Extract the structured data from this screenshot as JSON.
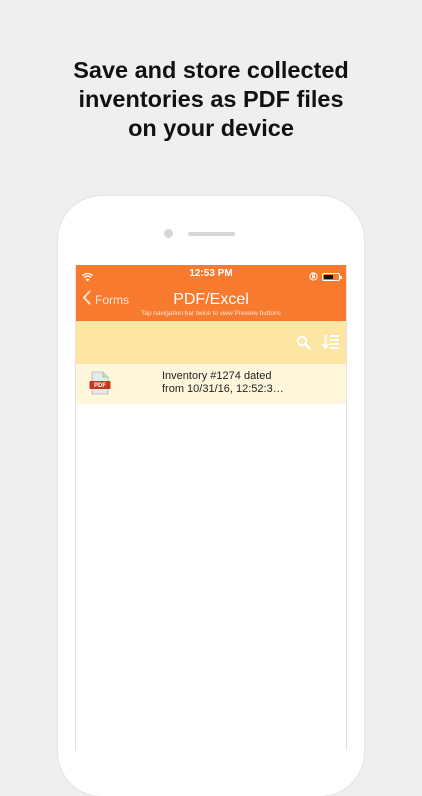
{
  "promo": {
    "line1": "Save and store collected",
    "line2": "inventories as PDF files",
    "line3": "on your device"
  },
  "status_bar": {
    "time": "12:53 PM",
    "battery_level": 0.65
  },
  "nav_bar": {
    "back_label": "Forms",
    "title": "PDF/Excel",
    "subtitle": "Tap navigation bar twice to view Preview buttons"
  },
  "file_list": [
    {
      "line1": "Inventory #1274 dated",
      "line2": "from 10/31/16, 12:52:3…",
      "badge": "PDF"
    }
  ],
  "colors": {
    "accent": "#f77a2f",
    "toolbar": "#fde6a4",
    "row": "#fff6dc",
    "pdf_badge": "#c8361a"
  }
}
